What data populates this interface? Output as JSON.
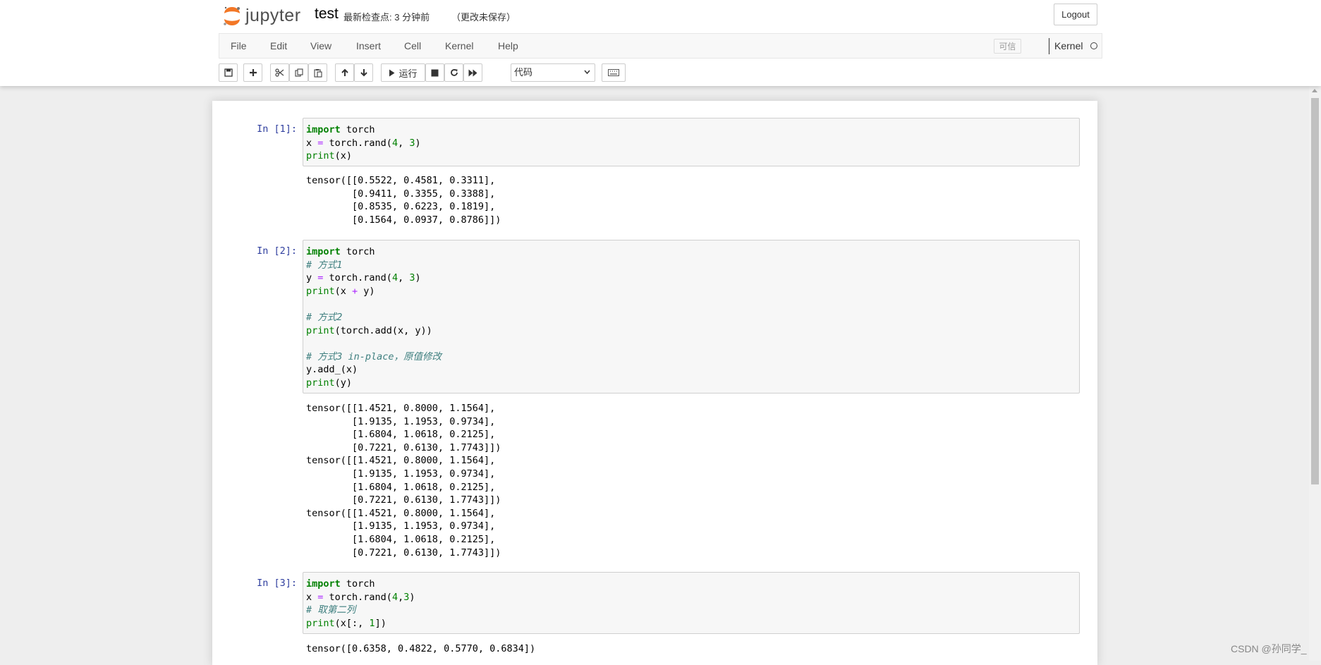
{
  "header": {
    "logo_text": "jupyter",
    "notebook_name": "test",
    "checkpoint_text": "最新检查点: 3 分钟前",
    "autosave_text": "（更改未保存）",
    "logout_label": "Logout"
  },
  "menubar": {
    "items": [
      "File",
      "Edit",
      "View",
      "Insert",
      "Cell",
      "Kernel",
      "Help"
    ],
    "trusted_label": "可信",
    "kernel_name": "Kernel"
  },
  "toolbar": {
    "run_label": "运行",
    "cell_type_value": "代码"
  },
  "cells": [
    {
      "prompt": "In [1]:",
      "code": [
        "import torch",
        "x = torch.rand(4, 3)",
        "print(x)"
      ],
      "output": "tensor([[0.5522, 0.4581, 0.3311],\n        [0.9411, 0.3355, 0.3388],\n        [0.8535, 0.6223, 0.1819],\n        [0.1564, 0.0937, 0.8786]])"
    },
    {
      "prompt": "In [2]:",
      "code": [
        "import torch",
        "# 方式1",
        "y = torch.rand(4, 3)",
        "print(x + y)",
        "",
        "# 方式2",
        "print(torch.add(x, y))",
        "",
        "# 方式3 in-place，原值修改",
        "y.add_(x)",
        "print(y)"
      ],
      "output": "tensor([[1.4521, 0.8000, 1.1564],\n        [1.9135, 1.1953, 0.9734],\n        [1.6804, 1.0618, 0.2125],\n        [0.7221, 0.6130, 1.7743]])\ntensor([[1.4521, 0.8000, 1.1564],\n        [1.9135, 1.1953, 0.9734],\n        [1.6804, 1.0618, 0.2125],\n        [0.7221, 0.6130, 1.7743]])\ntensor([[1.4521, 0.8000, 1.1564],\n        [1.9135, 1.1953, 0.9734],\n        [1.6804, 1.0618, 0.2125],\n        [0.7221, 0.6130, 1.7743]])"
    },
    {
      "prompt": "In [3]:",
      "code": [
        "import torch",
        "x = torch.rand(4,3)",
        "# 取第二列",
        "print(x[:, 1])"
      ],
      "output": "tensor([0.6358, 0.4822, 0.5770, 0.6834])"
    }
  ],
  "watermark": "CSDN @孙同学_"
}
